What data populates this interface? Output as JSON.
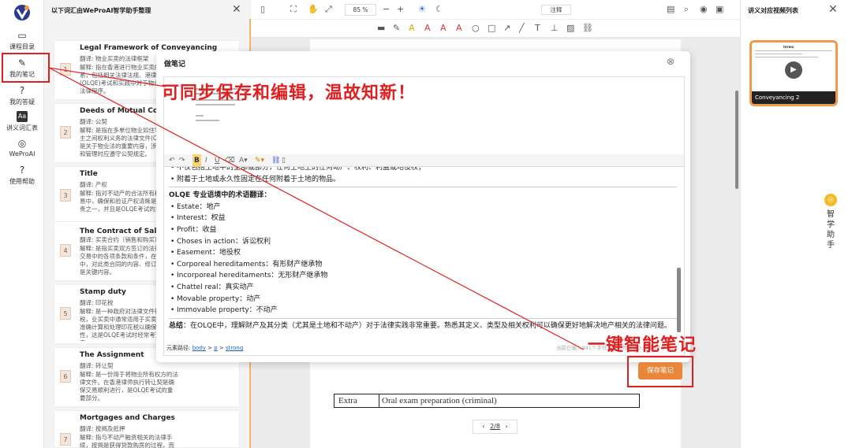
{
  "leftnav": {
    "items": [
      {
        "label": "课程目录",
        "icon": "folder-icon"
      },
      {
        "label": "我的笔记",
        "icon": "pen-icon"
      },
      {
        "label": "我的答疑",
        "icon": "question-icon"
      },
      {
        "label": "讲义词汇表",
        "icon": "vocabulary-icon"
      },
      {
        "label": "WeProAI",
        "icon": "weproai-icon"
      },
      {
        "label": "使用帮助",
        "icon": "help-icon"
      }
    ]
  },
  "vocab": {
    "title": "以下词汇由WeProAI智学助手整理",
    "cards": [
      {
        "num": "1",
        "term": "Legal Framework of Conveyancing",
        "translation": "翻译: 物业买卖的法律框架",
        "explanation": "解释: 指在香港进行物业买卖的法律体系，包括相关法律法规、港律师(OLQE)考试和实践中对于物业交易的法律程序。"
      },
      {
        "num": "2",
        "term": "Deeds of Mutual Covenant",
        "translation": "翻译: 公契",
        "explanation": "解释: 是指在多单位物业如住宅单位业主之间权利义务的法律文件(OLQE)中是关于物业法的重要内容，涉及买卖和管理时应遵守公契规定。"
      },
      {
        "num": "3",
        "term": "Title",
        "translation": "翻译: 产权",
        "explanation": "解释: 指对不动产的合法所有权，在交易中，确保和验证产权清晰是律师职责之一，并且是OLQE考试的重点。"
      },
      {
        "num": "4",
        "term": "The Contract of Sale (销售和购买)",
        "translation": "翻译: 买卖合约（销售和购买）",
        "explanation": "解释: 是指买卖双方签订的法律文件，交易中的各项条款和条件，在考试中，对此类合同的内容、修订的理解是关键内容。"
      },
      {
        "num": "5",
        "term": "Stamp duty",
        "translation": "翻译: 印花税",
        "explanation": "解释: 是一种政府对法律文件征收的税，业买卖中通常适用于买卖合约，准确计算和处理印花税以确保合法性，这是OLQE考试时经常考查的内容。"
      },
      {
        "num": "6",
        "term": "The Assignment",
        "translation": "翻译: 转让契",
        "explanation": "解释: 是一份用于将物业所有权方的法律文件。在香港律师执行转让契是确保交易顺利进行，是OLQE考试的重要部分。"
      },
      {
        "num": "7",
        "term": "Mortgages and Charges",
        "translation": "翻译: 按揭及抵押",
        "explanation": "解释: 指与不动产融资相关的法律手续，按揭是获得贷款购房的过程，而抵押通常指对物业债务"
      }
    ]
  },
  "toolbar": {
    "zoom": "85 %",
    "annotate": "注释"
  },
  "modal": {
    "title": "做笔记",
    "bullets_top": [
      "不仅包括土地中的全部或部分，任何土地上的任何动产、权利、利益或地役权；",
      "附着于土地或永久性固定在任何附着于土地的物品。"
    ],
    "heading": "OLQE 专业语境中的术语翻译：",
    "terms": [
      "Estate：地产",
      "Interest：权益",
      "Profit：收益",
      "Choses in action：诉讼权利",
      "Easement：地役权",
      "Corporeal hereditaments：有形财产继承物",
      "Incorporeal hereditaments：无形财产继承物",
      "Chattel real：真实动产",
      "Movable property：动产",
      "Immovable property：不动产"
    ],
    "summary_label": "总结",
    "summary_text": "：在OLQE中，理解财产及其分类（尤其是土地和不动产）对于法律实践非常重要。熟悉其定义、类型及相关权利可以确保更好地解决地产相关的法律问题。",
    "path_prefix": "元素路径: ",
    "path_body": "body",
    "path_sep1": " > ",
    "path_p": "p",
    "path_sep2": " > ",
    "path_strong": "strong",
    "char_count": "当前已输入841个字符，您还可以输入9159个字符。",
    "save_label": "保存笔记"
  },
  "document": {
    "table_col1": "Extra",
    "table_col2": "Oral exam preparation (criminal)",
    "page": "2/8"
  },
  "rightpanel": {
    "title": "讲义对应视频列表",
    "video_title": "Conveyancing 2",
    "thumb_heading": "terms"
  },
  "assistant": {
    "label": "智学助手"
  },
  "annotations": {
    "top": "可同步保存和编辑，温故知新！",
    "bottom": "一键智能笔记",
    "color": "#e02020"
  }
}
